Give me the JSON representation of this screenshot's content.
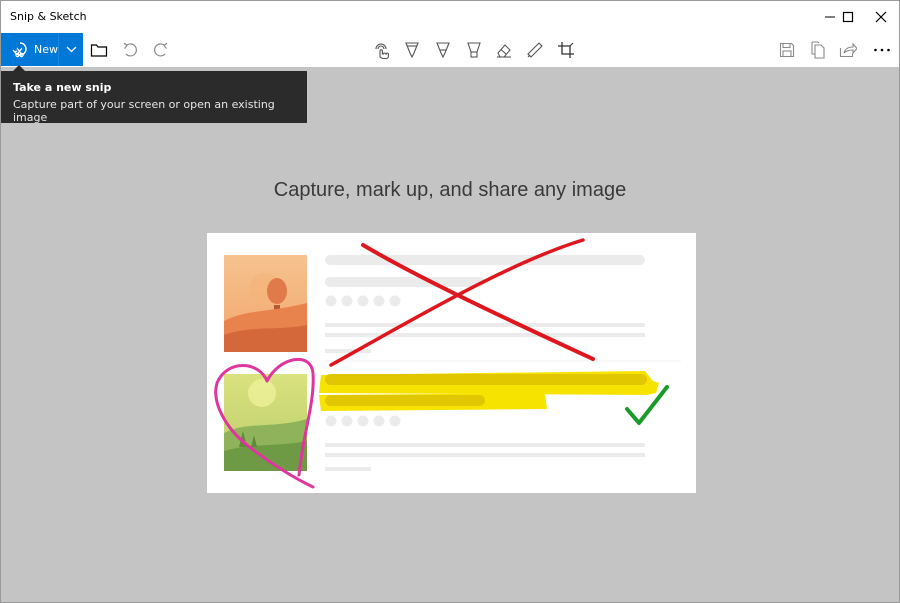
{
  "window": {
    "title": "Snip & Sketch"
  },
  "toolbar": {
    "new_label": "New",
    "buttons": {
      "open_file": "folder-icon",
      "undo": "undo-icon",
      "redo": "redo-icon",
      "touch_writing": "touch-writing-icon",
      "ballpoint_pen": "ballpoint-pen-icon",
      "pencil": "pencil-icon",
      "highlighter": "highlighter-icon",
      "eraser": "eraser-icon",
      "ruler": "ruler-icon",
      "crop": "crop-icon",
      "save": "save-icon",
      "copy": "copy-icon",
      "share": "share-icon",
      "more": "more-icon"
    }
  },
  "tooltip": {
    "title": "Take a new snip",
    "body": "Capture part of your screen or open an existing image"
  },
  "main": {
    "headline": "Capture, mark up, and share any image"
  },
  "colors": {
    "accent": "#0078d7",
    "canvas": "#c4c4c4",
    "tooltip_bg": "#2b2b2b"
  }
}
